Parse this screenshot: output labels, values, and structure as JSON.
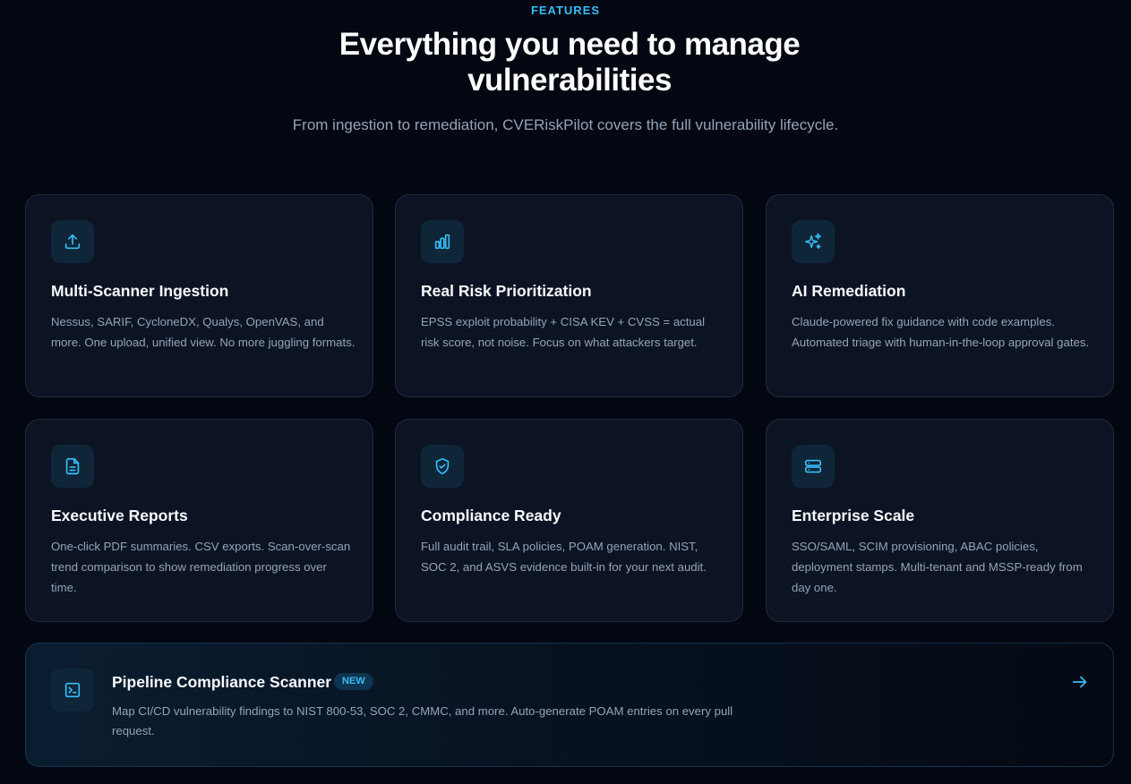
{
  "section": {
    "eyebrow": "FEATURES",
    "headline": "Everything you need to manage vulnerabilities",
    "subhead": "From ingestion to remediation, CVERiskPilot covers the full vulnerability lifecycle."
  },
  "features": [
    {
      "icon": "upload-icon",
      "title": "Multi-Scanner Ingestion",
      "description": "Nessus, SARIF, CycloneDX, Qualys, OpenVAS, and more. One upload, unified view. No more juggling formats."
    },
    {
      "icon": "bar-chart-icon",
      "title": "Real Risk Prioritization",
      "description": "EPSS exploit probability + CISA KEV + CVSS = actual risk score, not noise. Focus on what attackers target."
    },
    {
      "icon": "sparkles-icon",
      "title": "AI Remediation",
      "description": "Claude-powered fix guidance with code examples. Automated triage with human-in-the-loop approval gates."
    },
    {
      "icon": "document-icon",
      "title": "Executive Reports",
      "description": "One-click PDF summaries. CSV exports. Scan-over-scan trend comparison to show remediation progress over time."
    },
    {
      "icon": "shield-check-icon",
      "title": "Compliance Ready",
      "description": "Full audit trail, SLA policies, POAM generation. NIST, SOC 2, and ASVS evidence built-in for your next audit."
    },
    {
      "icon": "server-icon",
      "title": "Enterprise Scale",
      "description": "SSO/SAML, SCIM provisioning, ABAC policies, deployment stamps. Multi-tenant and MSSP-ready from day one."
    }
  ],
  "pipeline": {
    "icon": "terminal-icon",
    "title": "Pipeline Compliance Scanner",
    "badge": "NEW",
    "description": "Map CI/CD vulnerability findings to NIST 800-53, SOC 2, CMMC, and more. Auto-generate POAM entries on every pull request.",
    "arrow_icon": "arrow-right-icon"
  },
  "colors": {
    "background": "#030712",
    "card": "#0c1424",
    "accent": "#38bdf8",
    "muted_text": "#94a3b8"
  }
}
